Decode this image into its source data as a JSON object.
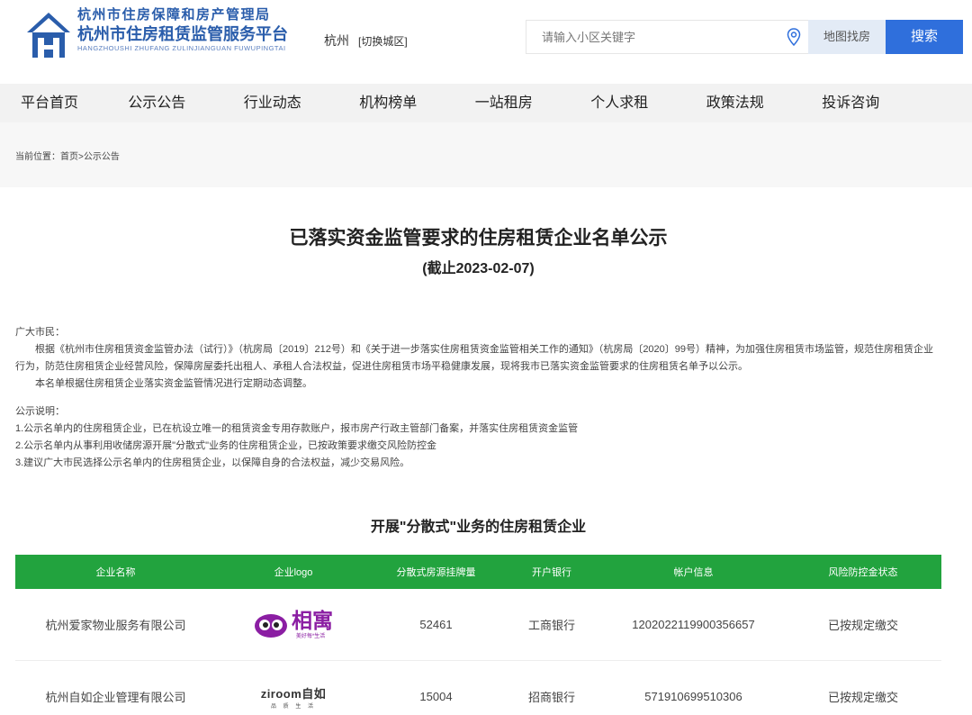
{
  "header": {
    "agency": "杭州市住房保障和房产管理局",
    "platform": "杭州市住房租赁监管服务平台",
    "platform_pinyin": "HANGZHOUSHI ZHUFANG ZULINJIANGUAN FUWUPINGTAI",
    "city": "杭州",
    "city_switch": "[切换城区]",
    "search_placeholder": "请输入小区关键字",
    "map_search_label": "地图找房",
    "search_label": "搜索"
  },
  "nav": {
    "items": [
      "平台首页",
      "公示公告",
      "行业动态",
      "机构榜单",
      "一站租房",
      "个人求租",
      "政策法规",
      "投诉咨询"
    ]
  },
  "breadcrumb": {
    "text": "当前位置：首页>公示公告"
  },
  "article": {
    "title": "已落实资金监管要求的住房租赁企业名单公示",
    "subtitle": "(截止2023-02-07)",
    "greeting": "广大市民：",
    "para1": "根据《杭州市住房租赁资金监管办法（试行）》（杭房局〔2019〕212号）和《关于进一步落实住房租赁资金监管相关工作的通知》（杭房局〔2020〕99号）精神，为加强住房租赁市场监管，规范住房租赁企业行为，防范住房租赁企业经营风险，保障房屋委托出租人、承租人合法权益，促进住房租赁市场平稳健康发展，现将我市已落实资金监管要求的住房租赁名单予以公示。",
    "para2": "本名单根据住房租赁企业落实资金监管情况进行定期动态调整。",
    "notes_heading": "公示说明：",
    "note1": "1.公示名单内的住房租赁企业，已在杭设立唯一的租赁资金专用存款账户，报市房产行政主管部门备案，并落实住房租赁资金监管",
    "note2": "2.公示名单内从事利用收储房源开展\"分散式\"业务的住房租赁企业，已按政策要求缴交风险防控金",
    "note3": "3.建议广大市民选择公示名单内的住房租赁企业，以保障自身的合法权益，减少交易风险。"
  },
  "section": {
    "title": "开展\"分散式\"业务的住房租赁企业"
  },
  "table": {
    "headers": [
      "企业名称",
      "企业logo",
      "分散式房源挂牌量",
      "开户银行",
      "帐户信息",
      "风险防控金状态"
    ],
    "rows": [
      {
        "name": "杭州爱家物业服务有限公司",
        "logo_text": "相寓",
        "logo_sub": "美好每*生活",
        "listings": "52461",
        "bank": "工商银行",
        "account": "1202022119900356657",
        "status": "已按规定缴交"
      },
      {
        "name": "杭州自如企业管理有限公司",
        "logo_text": "ziroom自如",
        "logo_sub": "品 质 生 活",
        "listings": "15004",
        "bank": "招商银行",
        "account": "571910699510306",
        "status": "已按规定缴交"
      }
    ]
  },
  "colors": {
    "brand_blue": "#2a5dab",
    "search_button": "#2f6fdc",
    "table_header": "#22a33e",
    "xiangyu_purple": "#8b1ea3"
  }
}
